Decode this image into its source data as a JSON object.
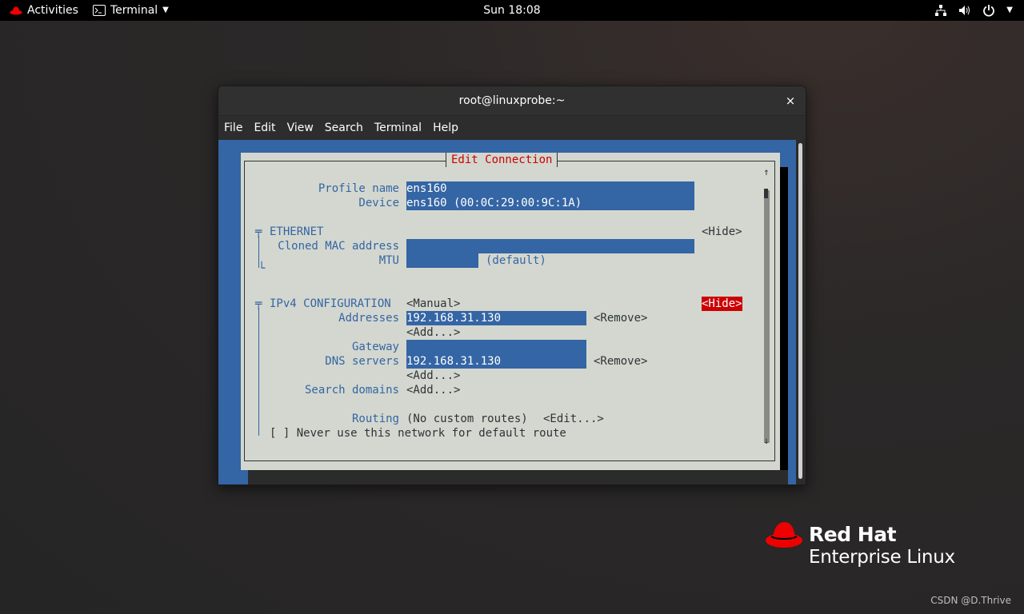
{
  "topbar": {
    "activities": "Activities",
    "app_name": "Terminal",
    "clock": "Sun 18:08"
  },
  "window": {
    "title": "root@linuxprobe:~",
    "close": "×",
    "menu": [
      "File",
      "Edit",
      "View",
      "Search",
      "Terminal",
      "Help"
    ]
  },
  "dialog": {
    "title": "Edit Connection",
    "profile_label": "Profile name",
    "profile_value": "ens160",
    "device_label": "Device",
    "device_value": "ens160 (00:0C:29:00:9C:1A)",
    "ethernet_header": "ETHERNET",
    "ethernet_hide": "<Hide>",
    "cloned_mac_label": "Cloned MAC address",
    "cloned_mac_value": "",
    "mtu_label": "MTU",
    "mtu_value": "",
    "mtu_hint": "(default)",
    "ipv4_header": "IPv4 CONFIGURATION",
    "ipv4_mode": "<Manual>",
    "ipv4_hide": "<Hide>",
    "addresses_label": "Addresses",
    "addresses_value": "192.168.31.130",
    "remove": "<Remove>",
    "add": "<Add...>",
    "gateway_label": "Gateway",
    "gateway_value": "",
    "dns_label": "DNS servers",
    "dns_value": "192.168.31.130",
    "search_domains_label": "Search domains",
    "routing_label": "Routing",
    "routing_value": "(No custom routes)",
    "routing_edit": "<Edit...>",
    "never_default": "[ ] Never use this network for default route",
    "scroll_up": "↑",
    "scroll_down": "↓"
  },
  "branding": {
    "line1": "Red Hat",
    "line2": "Enterprise Linux"
  },
  "watermark": "CSDN @D.Thrive",
  "colors": {
    "terminal_blue": "#3465a4",
    "dialog_bg": "#d3d7cf",
    "accent_red": "#cc0000"
  }
}
